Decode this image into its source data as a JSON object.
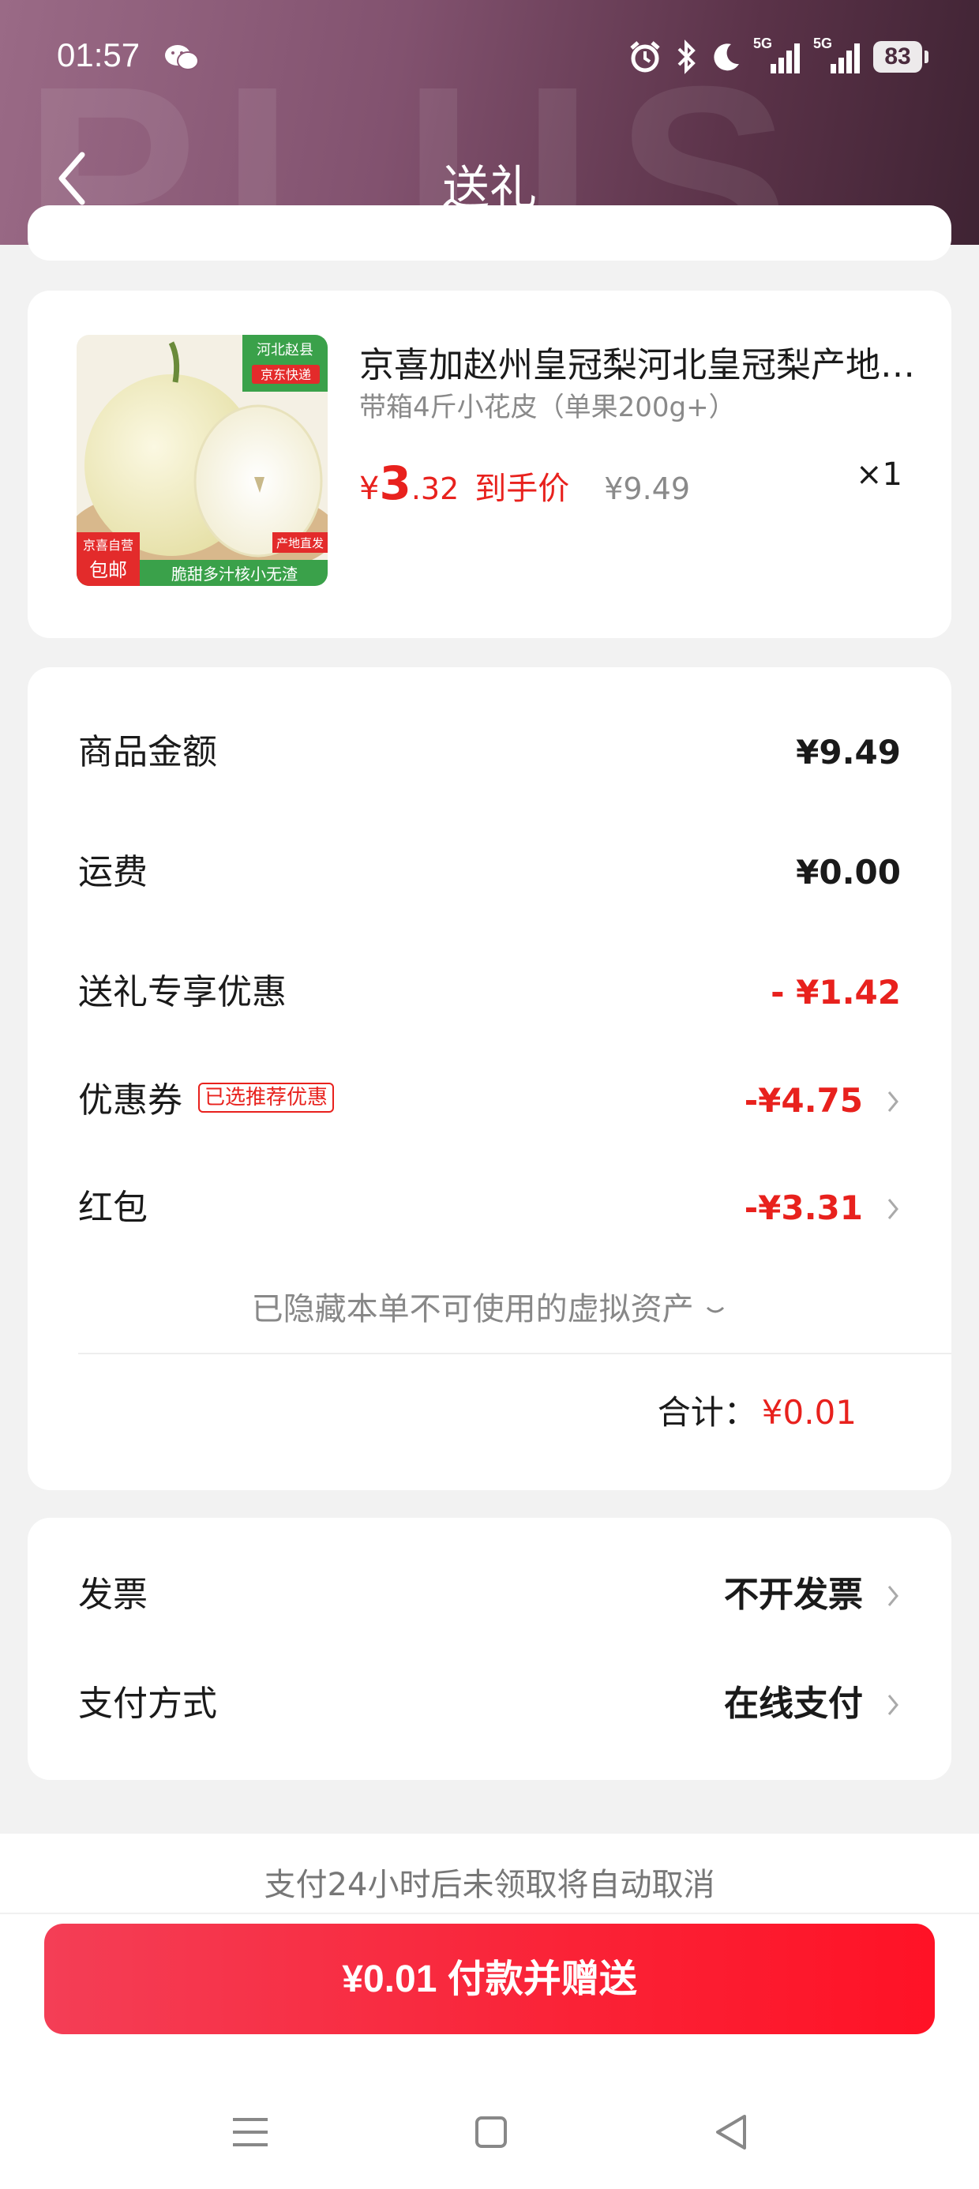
{
  "status_bar": {
    "time": "01:57",
    "network_1": "5G",
    "network_2": "5G",
    "battery": "83",
    "icons": [
      "wechat-icon",
      "alarm-icon",
      "bluetooth-icon",
      "moon-icon",
      "signal-icon",
      "signal-icon",
      "battery-icon"
    ]
  },
  "header": {
    "title": "送礼",
    "watermark": "PLUS",
    "back_icon": "chevron-left-icon"
  },
  "product": {
    "name": "京喜加赵州皇冠梨河北皇冠梨产地直发",
    "spec": "带箱4斤小花皮（单果200g+）",
    "price_symbol": "¥",
    "price_int": "3",
    "price_dec": ".32",
    "price_tag": "到手价",
    "original_price": "¥9.49",
    "quantity": "×1",
    "image_labels": {
      "origin": "河北赵县",
      "express": "京东快递",
      "self_run": "京喜自营",
      "free_ship": "包邮",
      "direct": "产地直发",
      "slogan": "脆甜多汁核小无渣"
    }
  },
  "summary": {
    "goods_label": "商品金额",
    "goods_value": "¥9.49",
    "shipping_label": "运费",
    "shipping_value": "¥0.00",
    "gift_discount_label": "送礼专享优惠",
    "gift_discount_value": "- ¥1.42",
    "coupon_label": "优惠券",
    "coupon_tag": "已选推荐优惠",
    "coupon_value": "-¥4.75",
    "redpacket_label": "红包",
    "redpacket_value": "-¥3.31",
    "hidden_assets": "已隐藏本单不可使用的虚拟资产",
    "total_label": "合计：",
    "total_value": "¥0.01",
    "accent_color": "#e8211d"
  },
  "invoice": {
    "invoice_label": "发票",
    "invoice_value": "不开发票",
    "payment_label": "支付方式",
    "payment_value": "在线支付"
  },
  "footer": {
    "notice": "支付24小时后未领取将自动取消",
    "pay_button": "¥0.01 付款并赠送",
    "button_color": "#fa2236"
  },
  "nav_bar": {
    "icons": [
      "menu-icon",
      "home-icon",
      "back-triangle-icon"
    ]
  }
}
